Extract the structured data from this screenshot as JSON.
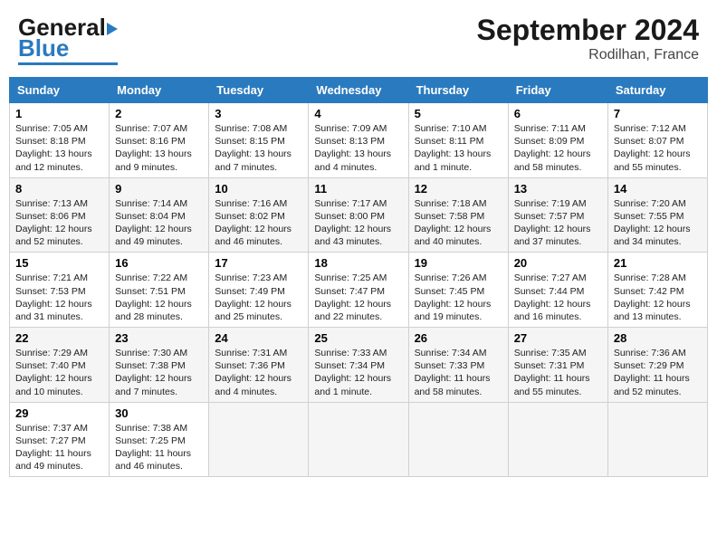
{
  "header": {
    "logo_general": "General",
    "logo_blue": "Blue",
    "month_title": "September 2024",
    "location": "Rodilhan, France"
  },
  "weekdays": [
    "Sunday",
    "Monday",
    "Tuesday",
    "Wednesday",
    "Thursday",
    "Friday",
    "Saturday"
  ],
  "weeks": [
    [
      {
        "day": "1",
        "info": "Sunrise: 7:05 AM\nSunset: 8:18 PM\nDaylight: 13 hours\nand 12 minutes."
      },
      {
        "day": "2",
        "info": "Sunrise: 7:07 AM\nSunset: 8:16 PM\nDaylight: 13 hours\nand 9 minutes."
      },
      {
        "day": "3",
        "info": "Sunrise: 7:08 AM\nSunset: 8:15 PM\nDaylight: 13 hours\nand 7 minutes."
      },
      {
        "day": "4",
        "info": "Sunrise: 7:09 AM\nSunset: 8:13 PM\nDaylight: 13 hours\nand 4 minutes."
      },
      {
        "day": "5",
        "info": "Sunrise: 7:10 AM\nSunset: 8:11 PM\nDaylight: 13 hours\nand 1 minute."
      },
      {
        "day": "6",
        "info": "Sunrise: 7:11 AM\nSunset: 8:09 PM\nDaylight: 12 hours\nand 58 minutes."
      },
      {
        "day": "7",
        "info": "Sunrise: 7:12 AM\nSunset: 8:07 PM\nDaylight: 12 hours\nand 55 minutes."
      }
    ],
    [
      {
        "day": "8",
        "info": "Sunrise: 7:13 AM\nSunset: 8:06 PM\nDaylight: 12 hours\nand 52 minutes."
      },
      {
        "day": "9",
        "info": "Sunrise: 7:14 AM\nSunset: 8:04 PM\nDaylight: 12 hours\nand 49 minutes."
      },
      {
        "day": "10",
        "info": "Sunrise: 7:16 AM\nSunset: 8:02 PM\nDaylight: 12 hours\nand 46 minutes."
      },
      {
        "day": "11",
        "info": "Sunrise: 7:17 AM\nSunset: 8:00 PM\nDaylight: 12 hours\nand 43 minutes."
      },
      {
        "day": "12",
        "info": "Sunrise: 7:18 AM\nSunset: 7:58 PM\nDaylight: 12 hours\nand 40 minutes."
      },
      {
        "day": "13",
        "info": "Sunrise: 7:19 AM\nSunset: 7:57 PM\nDaylight: 12 hours\nand 37 minutes."
      },
      {
        "day": "14",
        "info": "Sunrise: 7:20 AM\nSunset: 7:55 PM\nDaylight: 12 hours\nand 34 minutes."
      }
    ],
    [
      {
        "day": "15",
        "info": "Sunrise: 7:21 AM\nSunset: 7:53 PM\nDaylight: 12 hours\nand 31 minutes."
      },
      {
        "day": "16",
        "info": "Sunrise: 7:22 AM\nSunset: 7:51 PM\nDaylight: 12 hours\nand 28 minutes."
      },
      {
        "day": "17",
        "info": "Sunrise: 7:23 AM\nSunset: 7:49 PM\nDaylight: 12 hours\nand 25 minutes."
      },
      {
        "day": "18",
        "info": "Sunrise: 7:25 AM\nSunset: 7:47 PM\nDaylight: 12 hours\nand 22 minutes."
      },
      {
        "day": "19",
        "info": "Sunrise: 7:26 AM\nSunset: 7:45 PM\nDaylight: 12 hours\nand 19 minutes."
      },
      {
        "day": "20",
        "info": "Sunrise: 7:27 AM\nSunset: 7:44 PM\nDaylight: 12 hours\nand 16 minutes."
      },
      {
        "day": "21",
        "info": "Sunrise: 7:28 AM\nSunset: 7:42 PM\nDaylight: 12 hours\nand 13 minutes."
      }
    ],
    [
      {
        "day": "22",
        "info": "Sunrise: 7:29 AM\nSunset: 7:40 PM\nDaylight: 12 hours\nand 10 minutes."
      },
      {
        "day": "23",
        "info": "Sunrise: 7:30 AM\nSunset: 7:38 PM\nDaylight: 12 hours\nand 7 minutes."
      },
      {
        "day": "24",
        "info": "Sunrise: 7:31 AM\nSunset: 7:36 PM\nDaylight: 12 hours\nand 4 minutes."
      },
      {
        "day": "25",
        "info": "Sunrise: 7:33 AM\nSunset: 7:34 PM\nDaylight: 12 hours\nand 1 minute."
      },
      {
        "day": "26",
        "info": "Sunrise: 7:34 AM\nSunset: 7:33 PM\nDaylight: 11 hours\nand 58 minutes."
      },
      {
        "day": "27",
        "info": "Sunrise: 7:35 AM\nSunset: 7:31 PM\nDaylight: 11 hours\nand 55 minutes."
      },
      {
        "day": "28",
        "info": "Sunrise: 7:36 AM\nSunset: 7:29 PM\nDaylight: 11 hours\nand 52 minutes."
      }
    ],
    [
      {
        "day": "29",
        "info": "Sunrise: 7:37 AM\nSunset: 7:27 PM\nDaylight: 11 hours\nand 49 minutes."
      },
      {
        "day": "30",
        "info": "Sunrise: 7:38 AM\nSunset: 7:25 PM\nDaylight: 11 hours\nand 46 minutes."
      },
      {
        "day": "",
        "info": ""
      },
      {
        "day": "",
        "info": ""
      },
      {
        "day": "",
        "info": ""
      },
      {
        "day": "",
        "info": ""
      },
      {
        "day": "",
        "info": ""
      }
    ]
  ]
}
